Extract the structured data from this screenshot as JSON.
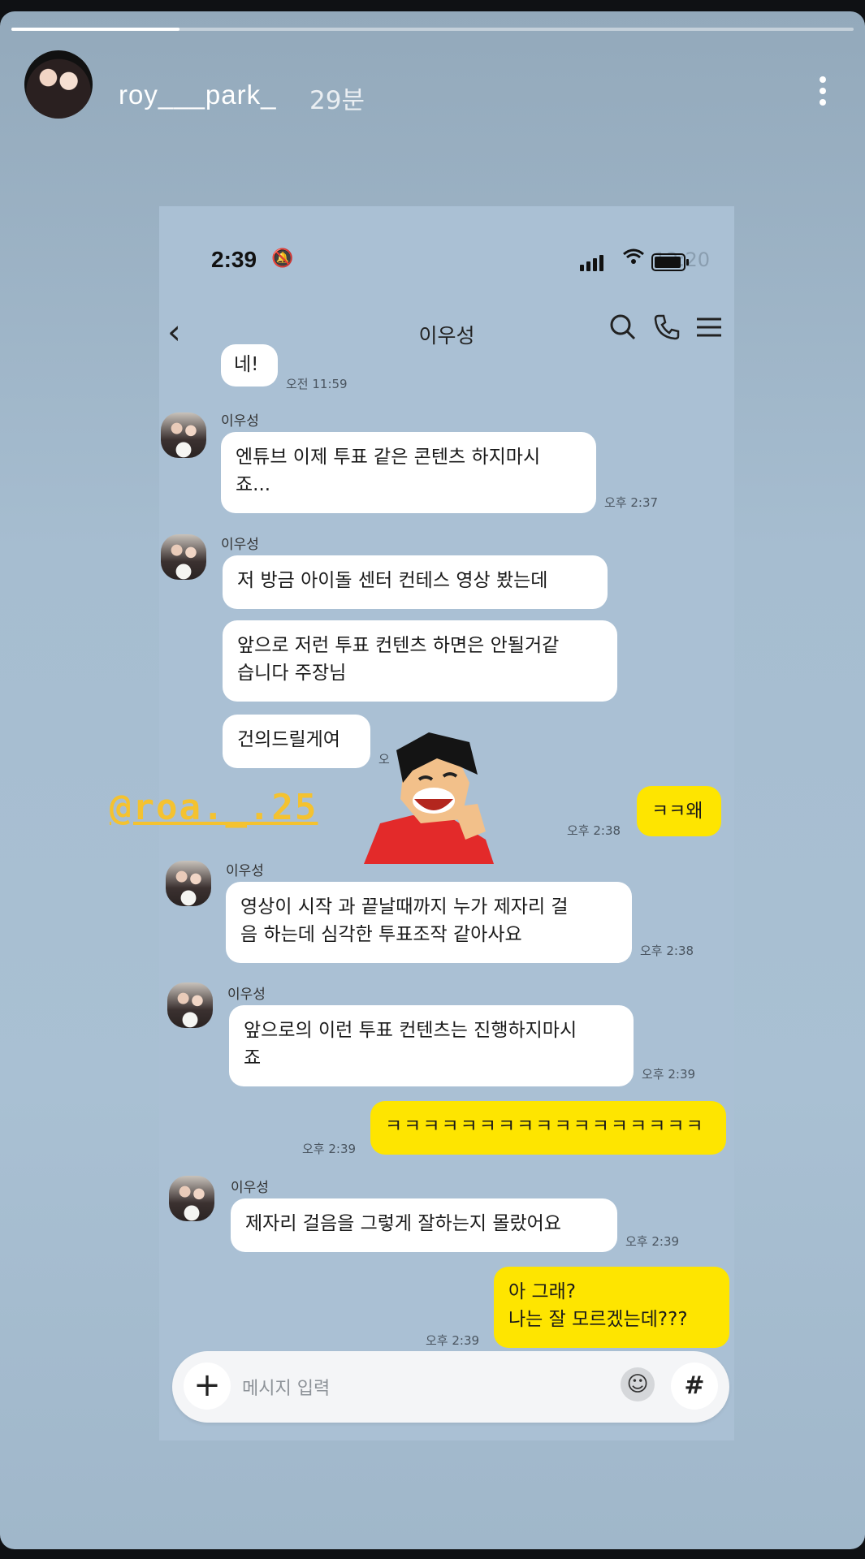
{
  "story": {
    "username": "roy___park_",
    "time_ago": "29분",
    "progress": 0.2
  },
  "phone": {
    "status_time": "2:39",
    "ghost_text": "12:20"
  },
  "chat": {
    "title": "이우성",
    "sender_name": "이우성",
    "messages": [
      {
        "text": "네!",
        "time": "오전 11:59"
      },
      {
        "text": "엔튜브 이제 투표 같은 콘텐츠 하지마시\n죠...",
        "time": "오후 2:37"
      },
      {
        "text": "저 방금 아이돌 센터 컨테스 영상 봤는데"
      },
      {
        "text": "앞으로 저런 투표 컨텐츠 하면은 안될거같\n습니다 주장님"
      },
      {
        "text": "건의드릴게여"
      },
      {
        "text": "ㅋㅋ왜",
        "time": "오후 2:38"
      },
      {
        "text": "영상이 시작 과 끝날때까지 누가 제자리 걸\n음 하는데 심각한 투표조작 같아사요",
        "time": "오후 2:38"
      },
      {
        "text": "앞으로의 이런 투표 컨텐츠는 진행하지마시\n죠",
        "time": "오후 2:39"
      },
      {
        "text": "ㅋㅋㅋㅋㅋㅋㅋㅋㅋㅋㅋㅋㅋㅋㅋㅋㅋ",
        "time": "오후 2:39"
      },
      {
        "text": "제자리 걸음을 그렇게 잘하는지 몰랐어요",
        "time": "오후 2:39"
      },
      {
        "text": "아 그래?\n나는 잘 모르겠는데???",
        "time": "오후 2:39"
      }
    ],
    "small_mark": "오"
  },
  "mention": "@roa._.25",
  "input": {
    "placeholder": "메시지 입력",
    "plus_icon": "+",
    "hash_icon": "#"
  },
  "icons": {
    "back": "chevron-left-icon",
    "search": "search-icon",
    "call": "phone-icon",
    "menu": "menu-icon",
    "emoji": "emoji-icon",
    "more": "more-vertical-icon"
  }
}
